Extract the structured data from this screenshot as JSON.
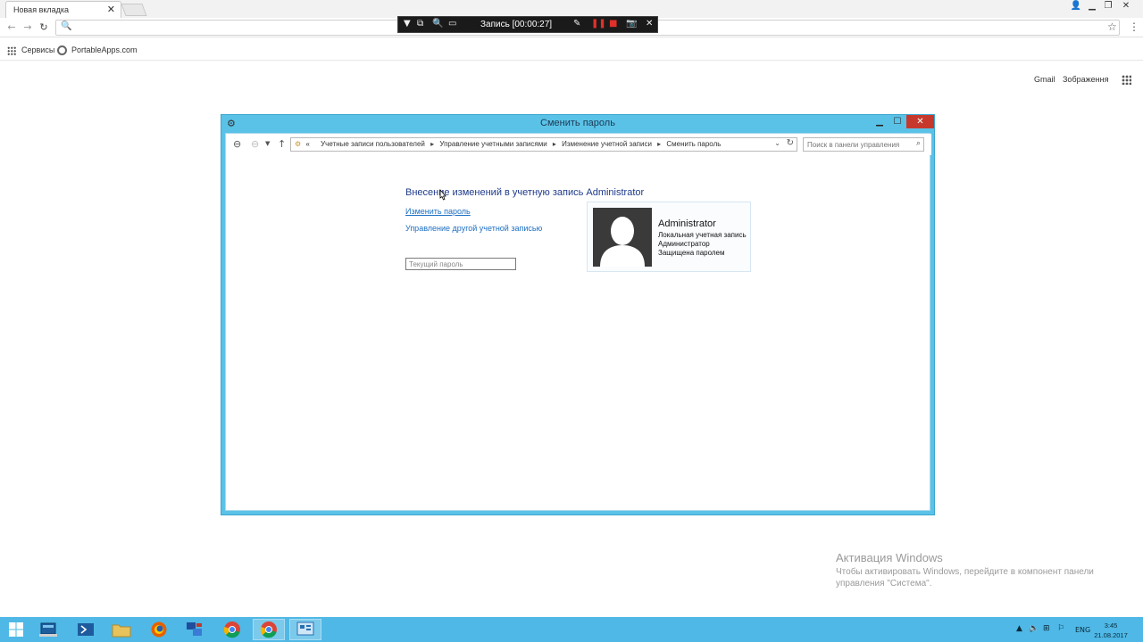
{
  "browser": {
    "tab_title": "Новая вкладка",
    "tab_close": "✕",
    "bookmarks": [
      "Сервисы",
      "PortableApps.com"
    ],
    "google_links": [
      "Gmail",
      "Зображення"
    ]
  },
  "recorder": {
    "title": "Запись [00:00:27]"
  },
  "dialog": {
    "title": "Сменить пароль",
    "breadcrumbs": [
      "«",
      "Учетные записи пользователей",
      "Управление учетными записями",
      "Изменение учетной записи",
      "Сменить пароль"
    ],
    "search_placeholder": "Поиск в панели управления",
    "heading": "Внесение изменений в учетную запись Administrator",
    "link_change_password": "Изменить пароль",
    "link_manage_other": "Управление другой учетной записью",
    "current_password_placeholder": "Текущий пароль",
    "user": {
      "name": "Administrator",
      "lines": [
        "Локальная учетная запись",
        "Администратор",
        "Защищена паролем"
      ]
    }
  },
  "activation": {
    "title": "Активация Windows",
    "text": "Чтобы активировать Windows, перейдите в компонент панели управления \"Система\"."
  },
  "taskbar": {
    "language": "ENG",
    "time": "3:45",
    "date": "21.08.2017"
  }
}
